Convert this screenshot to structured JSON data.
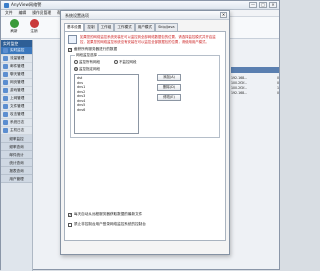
{
  "app": {
    "title": "AnyView网络警",
    "window_controls": [
      "—",
      "□",
      "✕"
    ],
    "menu": [
      "文件",
      "编辑",
      "操作员管理",
      "帮助"
    ]
  },
  "toolbar": [
    {
      "label": "刷新",
      "color": "#3a9a3a"
    },
    {
      "label": "注销",
      "color": "#c93a3a"
    }
  ],
  "sidebar": {
    "header": "实时监控",
    "items": [
      {
        "label": "实时监控",
        "selected": true
      },
      {
        "label": "流量管理",
        "selected": false
      },
      {
        "label": "邮件管理",
        "selected": false
      },
      {
        "label": "聊天管理",
        "selected": false
      },
      {
        "label": "网页管理",
        "selected": false
      },
      {
        "label": "游戏管理",
        "selected": false
      },
      {
        "label": "上网管理",
        "selected": false
      },
      {
        "label": "文件管理",
        "selected": false
      },
      {
        "label": "攻击管理",
        "selected": false
      },
      {
        "label": "系统日志",
        "selected": false
      },
      {
        "label": "主机日志",
        "selected": false
      }
    ],
    "groups": [
      "频率监控",
      "频率查询",
      "邮件统计",
      "统计查询",
      "报表查询",
      "用户管理"
    ]
  },
  "right_panel": {
    "rows": [
      [
        "192.168...",
        "0"
      ],
      [
        "100.2f2f...",
        "0"
      ],
      [
        "100.2f2f...",
        "1"
      ],
      [
        "192.168...",
        "0"
      ]
    ]
  },
  "dialog": {
    "title": "系统设置选项",
    "close": "✕",
    "tabs": [
      {
        "label": "基本设置",
        "active": true
      },
      {
        "label": "控制",
        "active": false
      },
      {
        "label": "工作组",
        "active": false
      },
      {
        "label": "工作模式",
        "active": false
      },
      {
        "label": "用户模式",
        "active": false
      },
      {
        "label": "Skip/Java",
        "active": false
      }
    ],
    "info_text": "如果您的网络监控系统安装在可以监控到全部网络数据包的位置，请选择监控模式并开启监控，如果您的网络监控系统没有安装在可以监控全部数据包的位置，请使用用户模式。",
    "monitor_all_label": "截获所有服务器进行的数据",
    "group_label": "网段监控选择",
    "radios": [
      {
        "label": "监控所有网段",
        "on": false
      },
      {
        "label": "不监控网段",
        "on": false
      },
      {
        "label": "监控指定网段",
        "on": true
      }
    ],
    "list_items": [
      "dst",
      "dns",
      "dns1",
      "dns2",
      "dns3",
      "dns4",
      "dns5",
      "dns6"
    ],
    "buttons": [
      "添加(A)",
      "删除(D)",
      "修改(E)"
    ],
    "bottom_checks": [
      {
        "label": "每天自动从远程服务器获取数据的最新文件",
        "checked": true
      },
      {
        "label": "禁止非控制台用户登录网络监控系统的控制台",
        "checked": false
      }
    ]
  }
}
